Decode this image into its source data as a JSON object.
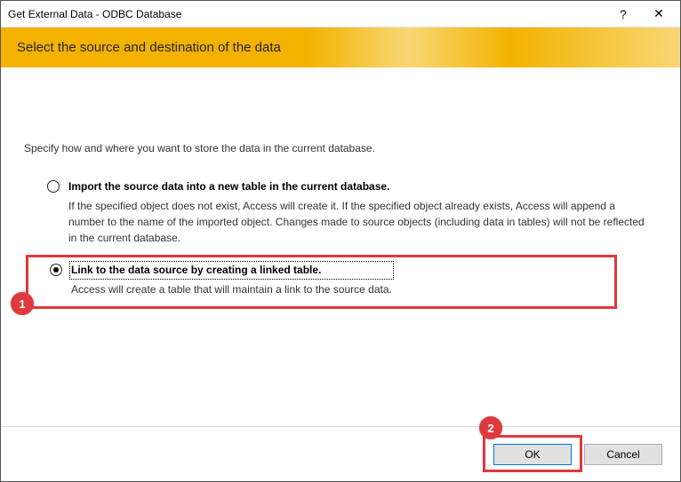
{
  "window": {
    "title": "Get External Data - ODBC Database",
    "help_symbol": "?",
    "close_symbol": "✕"
  },
  "header": {
    "heading": "Select the source and destination of the data"
  },
  "content": {
    "prompt": "Specify how and where you want to store the data in the current database.",
    "options": {
      "import": {
        "label": "Import the source data into a new table in the current database.",
        "desc": "If the specified object does not exist, Access will create it. If the specified object already exists, Access will append a number to the name of the imported object. Changes made to source objects (including data in tables) will not be reflected in the current database."
      },
      "link": {
        "label": "Link to the data source by creating a linked table.",
        "desc": "Access will create a table that will maintain a link to the source data."
      }
    }
  },
  "callouts": {
    "one": "1",
    "two": "2"
  },
  "footer": {
    "ok": "OK",
    "cancel": "Cancel"
  }
}
